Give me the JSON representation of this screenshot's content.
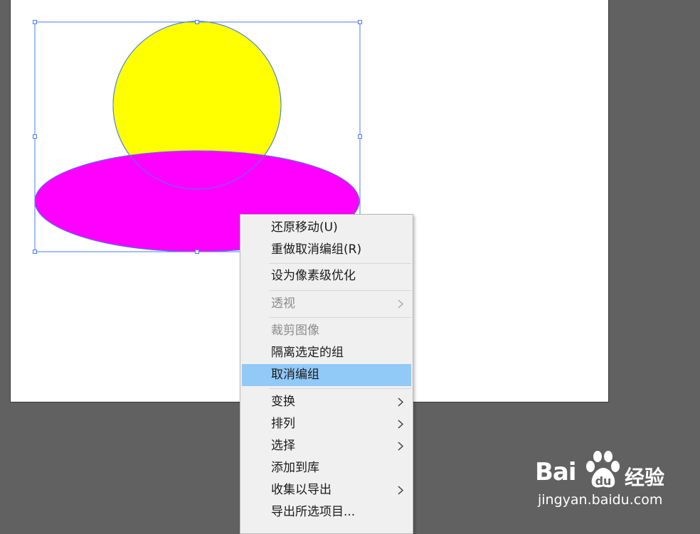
{
  "canvas": {
    "colors": {
      "background": "#616161",
      "artboard": "#ffffff",
      "circle_fill": "#ffff00",
      "ellipse_fill": "#ff00ff",
      "selection": "#4a7cf0"
    }
  },
  "context_menu": {
    "items": [
      {
        "label": "还原移动(U)",
        "enabled": true
      },
      {
        "label": "重做取消编组(R)",
        "enabled": true
      },
      {
        "label": "设为像素级优化",
        "enabled": true
      },
      {
        "label": "透视",
        "enabled": false,
        "submenu": true
      },
      {
        "label": "裁剪图像",
        "enabled": false
      },
      {
        "label": "隔离选定的组",
        "enabled": true
      },
      {
        "label": "取消编组",
        "enabled": true,
        "highlighted": true
      },
      {
        "label": "变换",
        "enabled": true,
        "submenu": true
      },
      {
        "label": "排列",
        "enabled": true,
        "submenu": true
      },
      {
        "label": "选择",
        "enabled": true,
        "submenu": true
      },
      {
        "label": "添加到库",
        "enabled": true
      },
      {
        "label": "收集以导出",
        "enabled": true,
        "submenu": true
      },
      {
        "label": "导出所选项目...",
        "enabled": true
      }
    ],
    "colors": {
      "background": "#f0f0f0",
      "highlight": "#91c9f7",
      "disabled_text": "#8c8c8c"
    }
  },
  "watermark": {
    "logo": "Bai  经验",
    "url": "jingyan.baidu.com"
  }
}
